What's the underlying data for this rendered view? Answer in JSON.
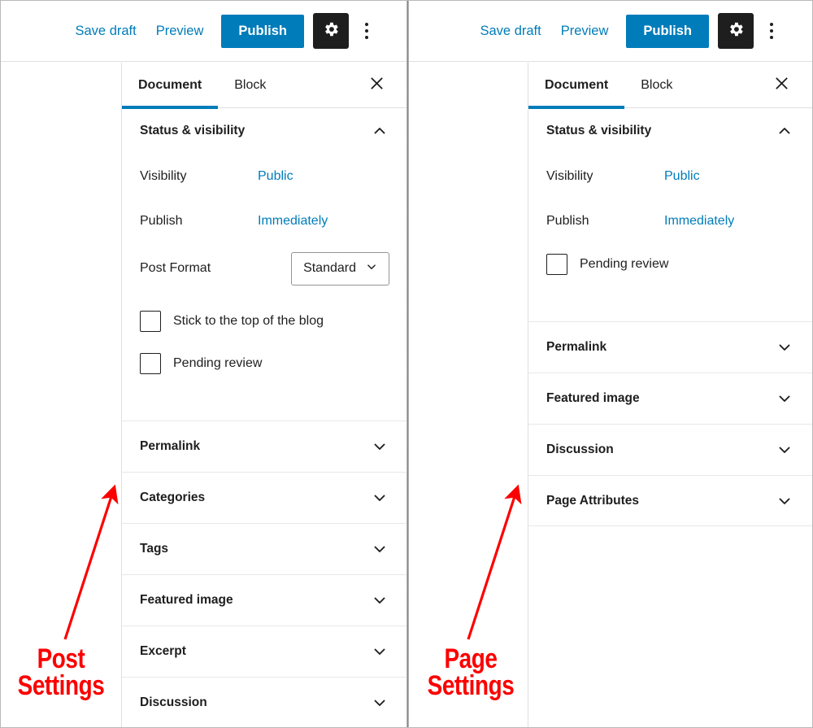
{
  "toolbar": {
    "save_draft": "Save draft",
    "preview": "Preview",
    "publish": "Publish",
    "settings_icon": "gear-icon",
    "more_icon": "kebab-menu-icon"
  },
  "tabs": {
    "document": "Document",
    "block": "Block",
    "close_icon": "close-icon",
    "active": "Document"
  },
  "post_panel": {
    "status_section": {
      "title": "Status & visibility",
      "expanded": true,
      "visibility_label": "Visibility",
      "visibility_value": "Public",
      "publish_label": "Publish",
      "publish_value": "Immediately",
      "post_format_label": "Post Format",
      "post_format_value": "Standard",
      "sticky_label": "Stick to the top of the blog",
      "sticky_checked": false,
      "pending_label": "Pending review",
      "pending_checked": false
    },
    "sections": [
      {
        "label": "Permalink",
        "expanded": false
      },
      {
        "label": "Categories",
        "expanded": false
      },
      {
        "label": "Tags",
        "expanded": false
      },
      {
        "label": "Featured image",
        "expanded": false
      },
      {
        "label": "Excerpt",
        "expanded": false
      },
      {
        "label": "Discussion",
        "expanded": false
      }
    ]
  },
  "page_panel": {
    "status_section": {
      "title": "Status & visibility",
      "expanded": true,
      "visibility_label": "Visibility",
      "visibility_value": "Public",
      "publish_label": "Publish",
      "publish_value": "Immediately",
      "pending_label": "Pending review",
      "pending_checked": false
    },
    "sections": [
      {
        "label": "Permalink",
        "expanded": false
      },
      {
        "label": "Featured image",
        "expanded": false
      },
      {
        "label": "Discussion",
        "expanded": false
      },
      {
        "label": "Page Attributes",
        "expanded": false
      }
    ]
  },
  "annotations": {
    "left": "Post\nSettings",
    "right": "Page\nSettings",
    "color": "#fc0000"
  },
  "colors": {
    "accent": "#007cba",
    "dark_button": "#1e1e1e",
    "annotation_red": "#fc0000",
    "border": "#e0e0e0"
  }
}
